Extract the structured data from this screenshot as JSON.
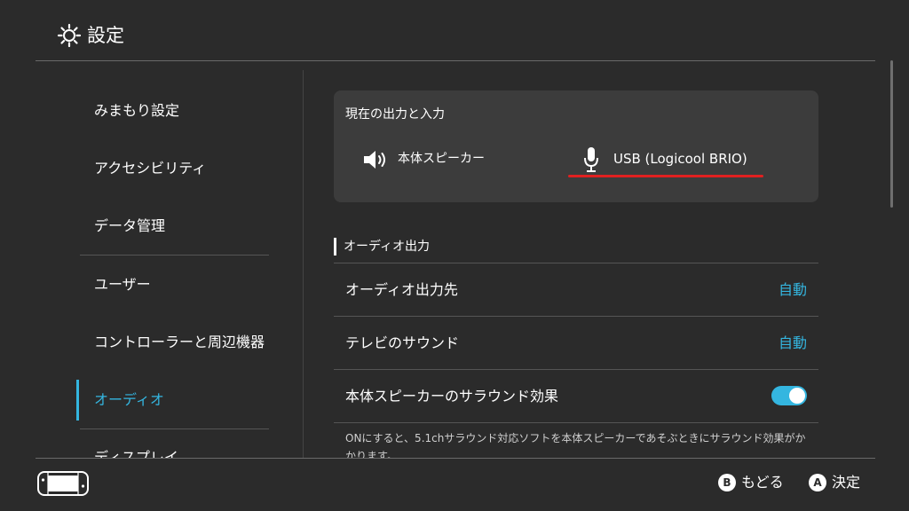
{
  "header": {
    "title": "設定",
    "icon": "gear-icon"
  },
  "sidebar": {
    "items": [
      {
        "label": "みまもり設定"
      },
      {
        "label": "アクセシビリティ"
      },
      {
        "label": "データ管理"
      },
      {
        "label": "ユーザー"
      },
      {
        "label": "コントローラーと周辺機器"
      },
      {
        "label": "オーディオ",
        "active": true
      },
      {
        "label": "ディスプレイ"
      }
    ]
  },
  "main": {
    "io_card": {
      "title": "現在の出力と入力",
      "output": {
        "label": "本体スピーカー",
        "icon": "speaker-icon"
      },
      "input": {
        "label": "USB (Logicool BRIO)",
        "icon": "microphone-icon"
      }
    },
    "audio_output_section": {
      "title": "オーディオ出力",
      "rows": [
        {
          "label": "オーディオ出力先",
          "value": "自動"
        },
        {
          "label": "テレビのサウンド",
          "value": "自動"
        },
        {
          "label": "本体スピーカーのサラウンド効果",
          "toggle": true
        }
      ],
      "note": "ONにすると、5.1chサラウンド対応ソフトを本体スピーカーであそぶときにサラウンド効果がかかります。"
    }
  },
  "footer": {
    "console_icon": "switch-console-icon",
    "back": {
      "key": "B",
      "label": "もどる"
    },
    "confirm": {
      "key": "A",
      "label": "決定"
    }
  },
  "colors": {
    "background": "#2b2b2b",
    "accent": "#34b6e0",
    "card": "#3c3c3c",
    "highlight_underline": "#e02020"
  }
}
